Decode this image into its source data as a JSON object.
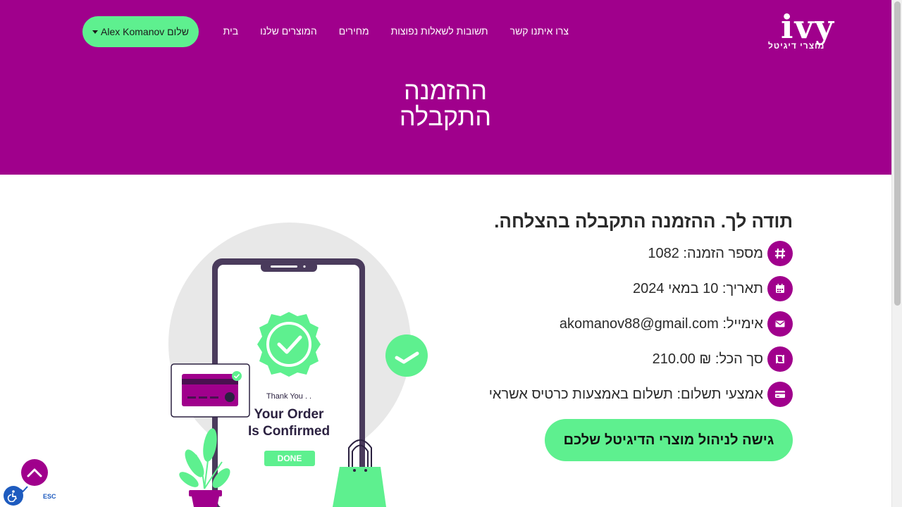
{
  "brand": {
    "mark": "ivy",
    "tagline": "מוצרי דיגיטל",
    "accent": "#a0008c",
    "highlight": "#5ef08f"
  },
  "nav": {
    "items": [
      "בית",
      "המוצרים שלנו",
      "מחירים",
      "תשובות לשאלות נפוצות",
      "צרו איתנו קשר"
    ],
    "user_label": "שלום Alex Komanov"
  },
  "hero": {
    "line1": "ההזמנה",
    "line2": "התקבלה"
  },
  "order": {
    "thanks": "תודה לך. ההזמנה התקבלה בהצלחה.",
    "number": "מספר הזמנה: 1082",
    "date": "תאריך: 10 במאי 2024",
    "email": "אימייל: akomanov88@gmail.com",
    "total": "סך הכל: ₪ 210.00",
    "payment": "אמצעי תשלום: תשלום באמצעות כרטיס אשראי",
    "icons": [
      "hash-icon",
      "calendar-icon",
      "envelope-icon",
      "shekel-icon",
      "credit-card-icon"
    ],
    "cta": "גישה לניהול מוצרי הדיגיטל שלכם"
  },
  "illustration": {
    "thank_you": "Thank You . .",
    "confirmed_line1": "Your Order",
    "confirmed_line2": "Is Confirmed",
    "done": "DONE"
  },
  "widgets": {
    "esc": "ESC"
  }
}
